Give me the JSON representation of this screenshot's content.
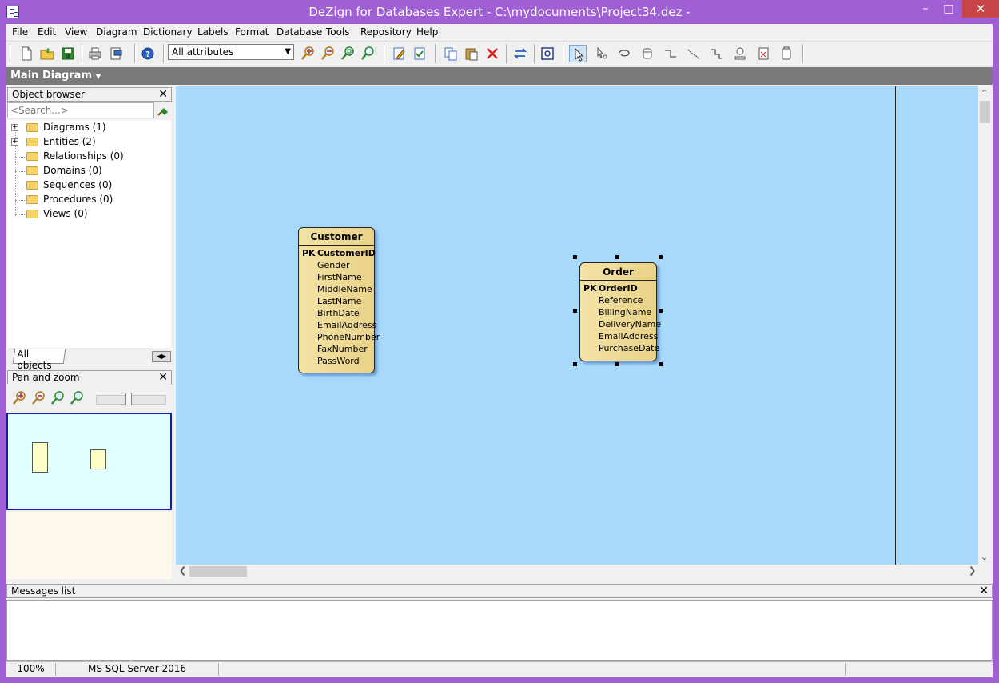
{
  "window": {
    "title": "DeZign for Databases Expert - C:\\mydocuments\\Project34.dez -",
    "minimize": "–",
    "maximize": "□",
    "close": "✕"
  },
  "colors": {
    "titlebar": "#a15fd6",
    "canvas": "#a8d8fa",
    "entity_fill": "#f0dc98",
    "minimap": "#e0ffff"
  },
  "menu": [
    "File",
    "Edit",
    "View",
    "Diagram",
    "Dictionary",
    "Labels",
    "Format",
    "Database",
    "Tools",
    "Repository",
    "Help"
  ],
  "toolbar": {
    "attribute_filter": "All attributes",
    "icons": [
      "new-file-icon",
      "open-folder-icon",
      "save-icon",
      "print-icon",
      "print-preview-icon",
      "help-icon",
      "zoom-in-icon",
      "zoom-out-icon",
      "zoom-fit-icon",
      "zoom-100-icon",
      "edit-icon",
      "check-icon",
      "copy-icon",
      "paste-icon",
      "delete-icon",
      "swap-icon",
      "screenshot-icon",
      "pointer-icon",
      "multi-select-icon",
      "lasso-icon",
      "entity-icon",
      "relationship-icon",
      "identifying-relationship-icon",
      "self-relationship-icon",
      "stamp-icon",
      "note-icon",
      "frame-icon"
    ]
  },
  "diagram_tab": "Main Diagram",
  "object_browser": {
    "title": "Object browser",
    "close": "✕",
    "search_placeholder": "<Search...>",
    "items": [
      {
        "label": "Diagrams (1)",
        "expandable": true
      },
      {
        "label": "Entities (2)",
        "expandable": true
      },
      {
        "label": "Relationships (0)",
        "expandable": false
      },
      {
        "label": "Domains (0)",
        "expandable": false
      },
      {
        "label": "Sequences (0)",
        "expandable": false
      },
      {
        "label": "Procedures (0)",
        "expandable": false
      },
      {
        "label": "Views (0)",
        "expandable": false
      }
    ],
    "tab": "All objects"
  },
  "pan_zoom": {
    "title": "Pan and zoom",
    "close": "✕"
  },
  "entities": [
    {
      "name": "Customer",
      "pk_label": "PK",
      "key": "CustomerID",
      "attributes": [
        "Gender",
        "FirstName",
        "MiddleName",
        "LastName",
        "BirthDate",
        "EmailAddress",
        "PhoneNumber",
        "FaxNumber",
        "PassWord"
      ]
    },
    {
      "name": "Order",
      "pk_label": "PK",
      "key": "OrderID",
      "attributes": [
        "Reference",
        "BillingName",
        "DeliveryName",
        "EmailAddress",
        "PurchaseDate"
      ]
    }
  ],
  "messages": {
    "title": "Messages list",
    "close": "✕"
  },
  "status": {
    "zoom": "100%",
    "database": "MS SQL Server 2016"
  }
}
